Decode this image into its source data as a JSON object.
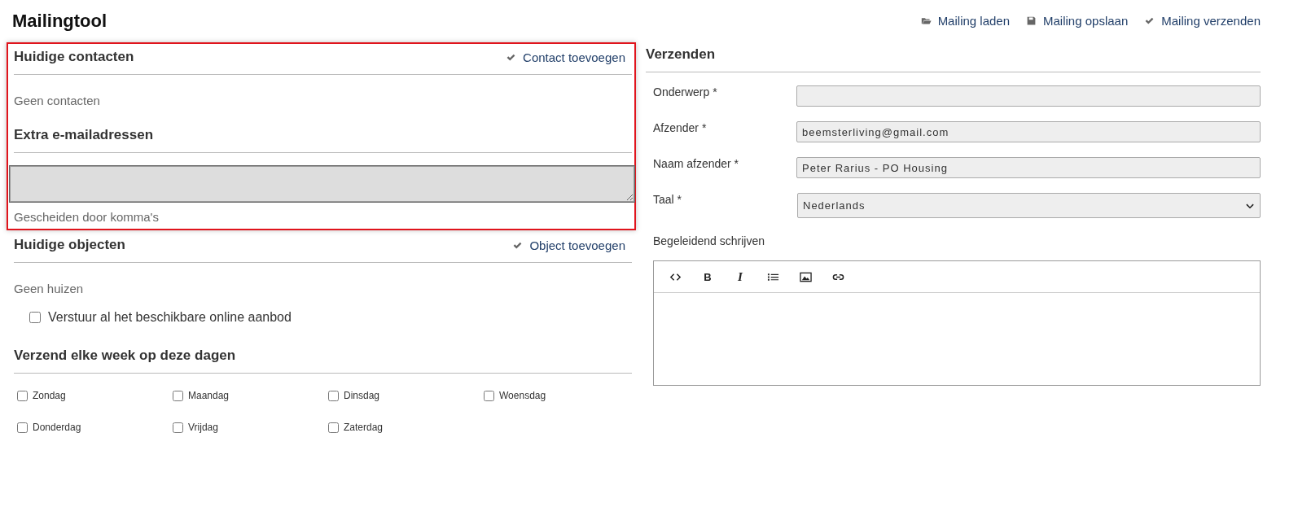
{
  "title": "Mailingtool",
  "actions": [
    {
      "kind": "folder",
      "label": "Mailing laden"
    },
    {
      "kind": "save",
      "label": "Mailing opslaan"
    },
    {
      "kind": "check",
      "label": "Mailing verzenden"
    }
  ],
  "contacts": {
    "heading": "Huidige contacten",
    "highlighted": true,
    "action": "Contact toevoegen",
    "empty": "Geen contacten",
    "extra_heading": "Extra e-mailadressen",
    "extra_field": {
      "focused": true
    },
    "hint": "Gescheiden door komma's"
  },
  "objects": {
    "heading": "Huidige objecten",
    "action": "Object toevoegen",
    "empty": "Geen huizen",
    "send_all": {
      "label": "Verstuur al het beschikbare online aanbod",
      "checked": false
    }
  },
  "schedule": {
    "heading": "Verzend elke week op deze dagen",
    "days": [
      {
        "label": "Zondag",
        "checked": false
      },
      {
        "label": "Maandag",
        "checked": false
      },
      {
        "label": "Dinsdag",
        "checked": false
      },
      {
        "label": "Woensdag",
        "checked": false
      },
      {
        "label": "Donderdag",
        "checked": false
      },
      {
        "label": "Vrijdag",
        "checked": false
      },
      {
        "label": "Zaterdag",
        "checked": false
      }
    ]
  },
  "send": {
    "heading": "Verzenden",
    "fields": [
      {
        "kind": "text",
        "label": "Onderwerp *"
      },
      {
        "kind": "text",
        "label": "Afzender *",
        "value": "beemsterliving@gmail.com"
      },
      {
        "kind": "text",
        "label": "Naam afzender *",
        "value": "Peter Rarius - PO Housing"
      },
      {
        "kind": "select",
        "label": "Taal *",
        "value": "Nederlands"
      }
    ],
    "editor": {
      "label": "Begeleidend schrijven",
      "toolbar": [
        {
          "kind": "code"
        },
        {
          "kind": "bold",
          "label": "B"
        },
        {
          "kind": "italic",
          "label": "I"
        },
        {
          "kind": "list"
        },
        {
          "kind": "image"
        },
        {
          "kind": "link"
        }
      ]
    }
  }
}
